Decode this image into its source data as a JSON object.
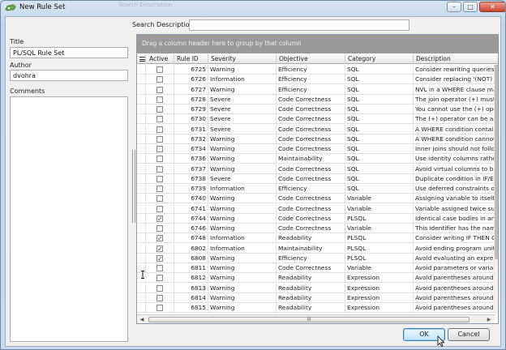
{
  "window": {
    "title": "New Rule Set",
    "ghost_title": "Search Description",
    "buttons": {
      "minimize": "–",
      "maximize": "□",
      "close": "✕"
    },
    "accent": "#c8442b"
  },
  "left_pane": {
    "title_label": "Title",
    "title_value": "PL/SQL Rule Set",
    "author_label": "Author",
    "author_value": "dvohra",
    "comments_label": "Comments",
    "comments_value": ""
  },
  "search": {
    "label": "Search Description",
    "value": ""
  },
  "grid": {
    "group_hint": "Drag a column header here to group by that column",
    "columns": [
      "Active",
      "Rule ID",
      "Severity",
      "Objective",
      "Category",
      "Description"
    ],
    "rows": [
      {
        "active": false,
        "id": "6725",
        "severity": "Warning",
        "objective": "Efficiency",
        "category": "SQL",
        "description": "Consider rewriting queries wit"
      },
      {
        "active": false,
        "id": "6726",
        "severity": "Information",
        "objective": "Efficiency",
        "category": "SQL",
        "description": "Consider replacing '(NOT) IN s"
      },
      {
        "active": false,
        "id": "6727",
        "severity": "Warning",
        "objective": "Efficiency",
        "category": "SQL",
        "description": "NVL in a WHERE clause may c"
      },
      {
        "active": false,
        "id": "6728",
        "severity": "Severe",
        "objective": "Code Correctness",
        "category": "SQL",
        "description": "The join operator (+) must be"
      },
      {
        "active": false,
        "id": "6729",
        "severity": "Severe",
        "objective": "Code Correctness",
        "category": "SQL",
        "description": "You cannot use the (+) operat"
      },
      {
        "active": false,
        "id": "6730",
        "severity": "Severe",
        "objective": "Code Correctness",
        "category": "SQL",
        "description": "The (+) operator can be appli"
      },
      {
        "active": false,
        "id": "6731",
        "severity": "Severe",
        "objective": "Code Correctness",
        "category": "SQL",
        "description": "A WHERE condition containin"
      },
      {
        "active": false,
        "id": "6732",
        "severity": "Warning",
        "objective": "Code Correctness",
        "category": "SQL",
        "description": "A WHERE condition cannot u"
      },
      {
        "active": false,
        "id": "6734",
        "severity": "Warning",
        "objective": "Code Correctness",
        "category": "SQL",
        "description": "Inner joins should not follow o"
      },
      {
        "active": false,
        "id": "6736",
        "severity": "Warning",
        "objective": "Maintainability",
        "category": "SQL",
        "description": "Use identity columns rather th"
      },
      {
        "active": false,
        "id": "6737",
        "severity": "Warning",
        "objective": "Code Correctness",
        "category": "SQL",
        "description": "Avoid virtual columns to be v"
      },
      {
        "active": false,
        "id": "6738",
        "severity": "Severe",
        "objective": "Code Correctness",
        "category": "SQL",
        "description": "Duplicate condition in IF/ELSI"
      },
      {
        "active": false,
        "id": "6739",
        "severity": "Information",
        "objective": "Efficiency",
        "category": "SQL",
        "description": "Use deferred constraints only"
      },
      {
        "active": false,
        "id": "6740",
        "severity": "Warning",
        "objective": "Code Correctness",
        "category": "Variable",
        "description": "Assigning variable to itself (A"
      },
      {
        "active": false,
        "id": "6741",
        "severity": "Warning",
        "objective": "Code Correctness",
        "category": "Variable",
        "description": "Variable assigned twice succe"
      },
      {
        "active": true,
        "id": "6744",
        "severity": "Warning",
        "objective": "Code Correctness",
        "category": "PLSQL",
        "description": "Identical case bodies in an IF"
      },
      {
        "active": false,
        "id": "6746",
        "severity": "Warning",
        "objective": "Code Correctness",
        "category": "Variable",
        "description": "This identifier has the name o"
      },
      {
        "active": true,
        "id": "6748",
        "severity": "Information",
        "objective": "Readability",
        "category": "PLSQL",
        "description": "Consider writing IF THEN CON"
      },
      {
        "active": true,
        "id": "6802",
        "severity": "Information",
        "objective": "Maintainability",
        "category": "PLSQL",
        "description": "Avoid ending program units te"
      },
      {
        "active": true,
        "id": "6808",
        "severity": "Warning",
        "objective": "Efficiency",
        "category": "PLSQL",
        "description": "Avoid evaluating an expressio"
      },
      {
        "active": false,
        "id": "6811",
        "severity": "Warning",
        "objective": "Code Correctness",
        "category": "Variable",
        "description": "Avoid parameters or variables"
      },
      {
        "active": false,
        "id": "6812",
        "severity": "Warning",
        "objective": "Readability",
        "category": "Expression",
        "description": "Avoid parentheses around th"
      },
      {
        "active": false,
        "id": "6813",
        "severity": "Warning",
        "objective": "Readability",
        "category": "Expression",
        "description": "Avoid parentheses around sir"
      },
      {
        "active": false,
        "id": "6814",
        "severity": "Warning",
        "objective": "Readability",
        "category": "Expression",
        "description": "Avoid parentheses around th"
      },
      {
        "active": false,
        "id": "6815",
        "severity": "Warning",
        "objective": "Readability",
        "category": "Expression",
        "description": "Avoid parentheses around or"
      }
    ],
    "hscroll_grip": "III"
  },
  "footer": {
    "ok_label": "OK",
    "cancel_label": "Cancel"
  }
}
